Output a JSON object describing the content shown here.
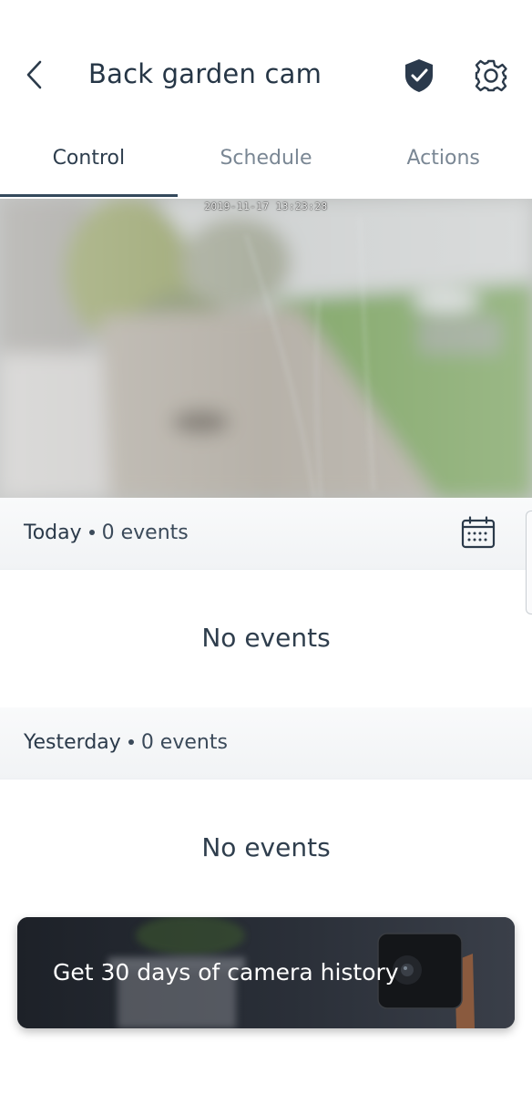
{
  "header": {
    "title": "Back garden cam",
    "back_icon": "chevron-left-icon",
    "shield_icon": "shield-check-icon",
    "settings_icon": "gear-icon"
  },
  "tabs": [
    {
      "label": "Control",
      "active": true
    },
    {
      "label": "Schedule",
      "active": false
    },
    {
      "label": "Actions",
      "active": false
    }
  ],
  "camera": {
    "timestamp": "2019-11-17 13:23:28"
  },
  "events": [
    {
      "day": "Today",
      "count": "0 events",
      "empty_text": "No events"
    },
    {
      "day": "Yesterday",
      "count": "0 events",
      "empty_text": "No events"
    }
  ],
  "calendar_icon": "calendar-icon",
  "promo": {
    "text": "Get 30 days of camera history"
  },
  "colors": {
    "text_primary": "#263646",
    "tab_inactive": "#7a8794",
    "tab_indicator": "#34495c",
    "promo_bg": "#1f232a"
  }
}
